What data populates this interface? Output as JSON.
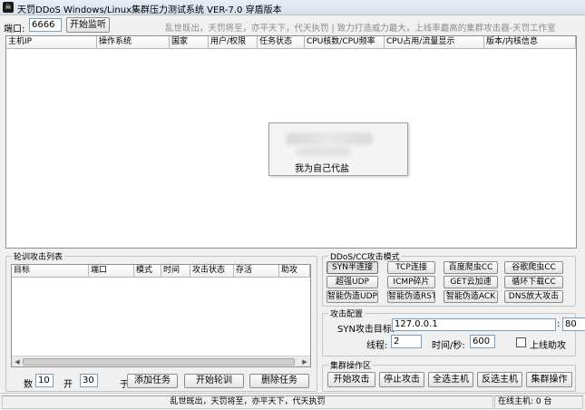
{
  "window": {
    "title": "天罚DDoS Windows/Linux集群压力测试系统 VER-7.0 穿盾版本"
  },
  "toolbar": {
    "port_label": "端口:",
    "port_value": "6666",
    "listen_button": "开始监听",
    "slogan": "乱世既出，天罚将至，亦平天下，代天执罚 | 致力打造威力最大，上线率最高的集群攻击器-天罚工作室"
  },
  "host_list": {
    "columns": [
      "主机IP",
      "操作系统",
      "国家",
      "用户/权限",
      "任务状态",
      "CPU核数/CPU频率",
      "CPU占用/流量显示",
      "版本/内核信息"
    ]
  },
  "popup": {
    "text": "我为自己代盐"
  },
  "task_list": {
    "title": "轮训攻击列表",
    "columns": [
      "目标",
      "端口",
      "模式",
      "时间",
      "攻击状态",
      "存活",
      "助攻"
    ]
  },
  "task_bottom": {
    "label_1": "数",
    "value_1": "10",
    "label_2": "开",
    "value_2": "30",
    "label_3": "于",
    "add_button": "添加任务",
    "rotate_button": "开始轮训",
    "delete_button": "删除任务"
  },
  "modes": {
    "title": "DDoS/CC攻击模式",
    "buttons": [
      "SYN半连接",
      "TCP连接",
      "百度爬虫CC",
      "谷歌爬虫CC",
      "超强UDP",
      "ICMP碎片",
      "GET云加速",
      "循环下载CC",
      "智能伪造UDP",
      "智能伪造RST",
      "智能伪造ACK",
      "DNS放大攻击"
    ],
    "selected": "SYN半连接"
  },
  "attack_config": {
    "title": "攻击配置",
    "target_label": "SYN攻击目标:",
    "target_value": "127.0.0.1",
    "colon": ":",
    "port_value": "80",
    "threads_label": "线程:",
    "threads_value": "2",
    "time_label": "时间/秒:",
    "time_value": "600",
    "online_assist_label": "上线助攻"
  },
  "cluster": {
    "title": "集群操作区",
    "buttons": [
      "开始攻击",
      "停止攻击",
      "全选主机",
      "反选主机",
      "集群操作"
    ]
  },
  "statusbar": {
    "slogan": "乱世既出，天罚将至，亦平天下，代天执罚",
    "online_hosts": "在线主机: 0 台"
  }
}
